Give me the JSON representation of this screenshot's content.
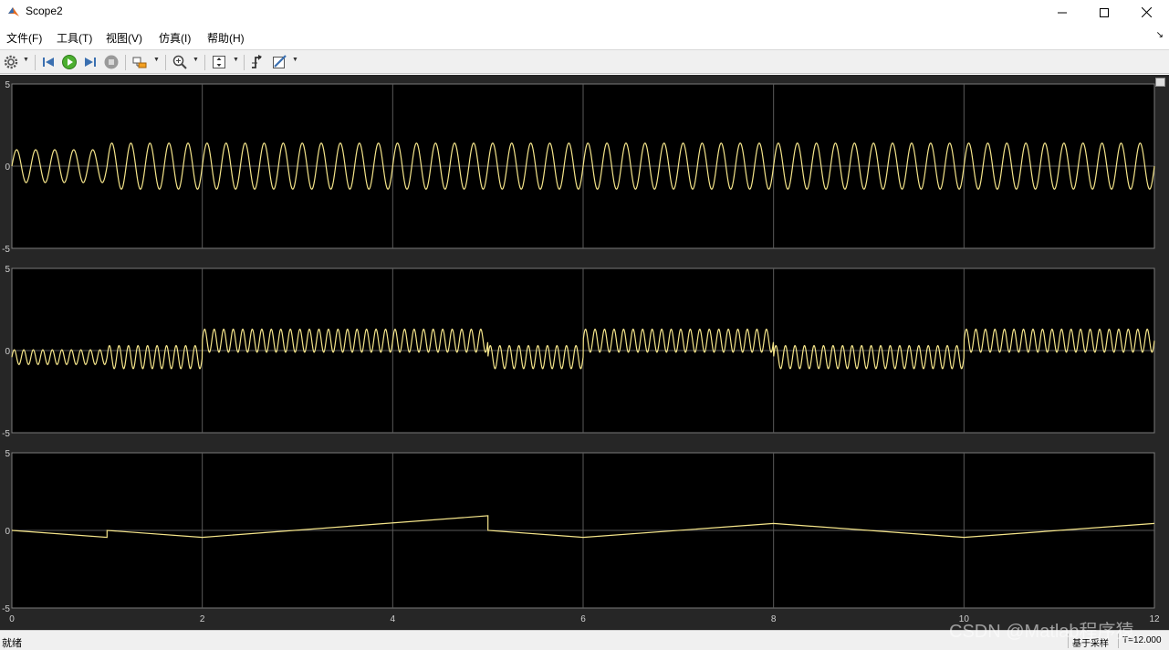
{
  "window": {
    "title": "Scope2",
    "icon": "matlab-icon",
    "controls": [
      "minimize-icon",
      "maximize-icon",
      "close-icon"
    ]
  },
  "menu": {
    "items": [
      {
        "label": "文件(F)"
      },
      {
        "label": "工具(T)"
      },
      {
        "label": "视图(V)"
      },
      {
        "label": "仿真(I)"
      },
      {
        "label": "帮助(H)"
      }
    ],
    "collapse_glyph": "↘"
  },
  "toolbar": {
    "buttons": [
      {
        "name": "settings-button",
        "icon": "gear-icon",
        "dropdown": true
      },
      {
        "name": "step-back-button",
        "icon": "step-back-icon"
      },
      {
        "name": "run-button",
        "icon": "play-icon"
      },
      {
        "name": "step-forward-button",
        "icon": "step-forward-icon"
      },
      {
        "name": "stop-button",
        "icon": "stop-icon"
      },
      {
        "name": "highlight-button",
        "icon": "highlight-block-icon",
        "dropdown": true
      },
      {
        "name": "zoom-button",
        "icon": "zoom-icon",
        "dropdown": true
      },
      {
        "name": "scale-button",
        "icon": "autoscale-icon",
        "dropdown": true
      },
      {
        "name": "triggers-button",
        "icon": "trigger-icon"
      },
      {
        "name": "style-button",
        "icon": "style-icon",
        "dropdown": true
      }
    ]
  },
  "scope": {
    "background": "#262626",
    "axes_background": "#000000",
    "grid_color": "#5a5a5a",
    "trace_color": "#f5e58a",
    "x_ticks": [
      "0",
      "2",
      "4",
      "6",
      "8",
      "10",
      "12"
    ],
    "y_ticks": [
      "5",
      "0",
      "-5"
    ]
  },
  "chart_data": [
    {
      "type": "line",
      "title": "",
      "xlabel": "",
      "ylabel": "",
      "xlim": [
        0,
        12
      ],
      "ylim": [
        -5,
        5
      ],
      "grid": true,
      "series": [
        {
          "description": "sinusoid, period about 0.2 s; amplitude about 1.0 for t in [0,1], about 1.4 for t in [1,12]",
          "segments": [
            {
              "t": [
                0,
                1
              ],
              "offset": 0,
              "amplitude": 1.0,
              "period": 0.2
            },
            {
              "t": [
                1,
                12
              ],
              "offset": 0,
              "amplitude": 1.4,
              "period": 0.2
            }
          ]
        }
      ]
    },
    {
      "type": "line",
      "title": "",
      "xlabel": "",
      "ylabel": "",
      "xlim": [
        0,
        12
      ],
      "ylim": [
        -5,
        5
      ],
      "grid": true,
      "series": [
        {
          "description": "sinusoid with a piecewise-constant offset, period about 0.1 s",
          "segments": [
            {
              "t": [
                0,
                1
              ],
              "offset": -0.4,
              "amplitude": 0.45,
              "period": 0.1
            },
            {
              "t": [
                1,
                2
              ],
              "offset": -0.4,
              "amplitude": 0.7,
              "period": 0.1
            },
            {
              "t": [
                2,
                5
              ],
              "offset": 0.6,
              "amplitude": 0.7,
              "period": 0.1
            },
            {
              "t": [
                5,
                6
              ],
              "offset": -0.4,
              "amplitude": 0.7,
              "period": 0.1
            },
            {
              "t": [
                6,
                8
              ],
              "offset": 0.6,
              "amplitude": 0.7,
              "period": 0.1
            },
            {
              "t": [
                8,
                10
              ],
              "offset": -0.4,
              "amplitude": 0.7,
              "period": 0.1
            },
            {
              "t": [
                10,
                12
              ],
              "offset": 0.6,
              "amplitude": 0.7,
              "period": 0.1
            }
          ]
        }
      ]
    },
    {
      "type": "line",
      "title": "",
      "xlabel": "",
      "ylabel": "",
      "xlim": [
        0,
        12
      ],
      "ylim": [
        -5,
        5
      ],
      "grid": true,
      "series": [
        {
          "points": [
            [
              0,
              0
            ],
            [
              1,
              -0.45
            ],
            [
              1,
              0
            ],
            [
              2,
              -0.45
            ],
            [
              5,
              0.95
            ],
            [
              5,
              0
            ],
            [
              6,
              -0.45
            ],
            [
              8,
              0.45
            ],
            [
              10,
              -0.45
            ],
            [
              12,
              0.45
            ]
          ]
        }
      ]
    }
  ],
  "status": {
    "text": "就绪",
    "mode": "基于采样",
    "time": "T=12.000"
  },
  "watermark": "CSDN @Matlab程序猿"
}
